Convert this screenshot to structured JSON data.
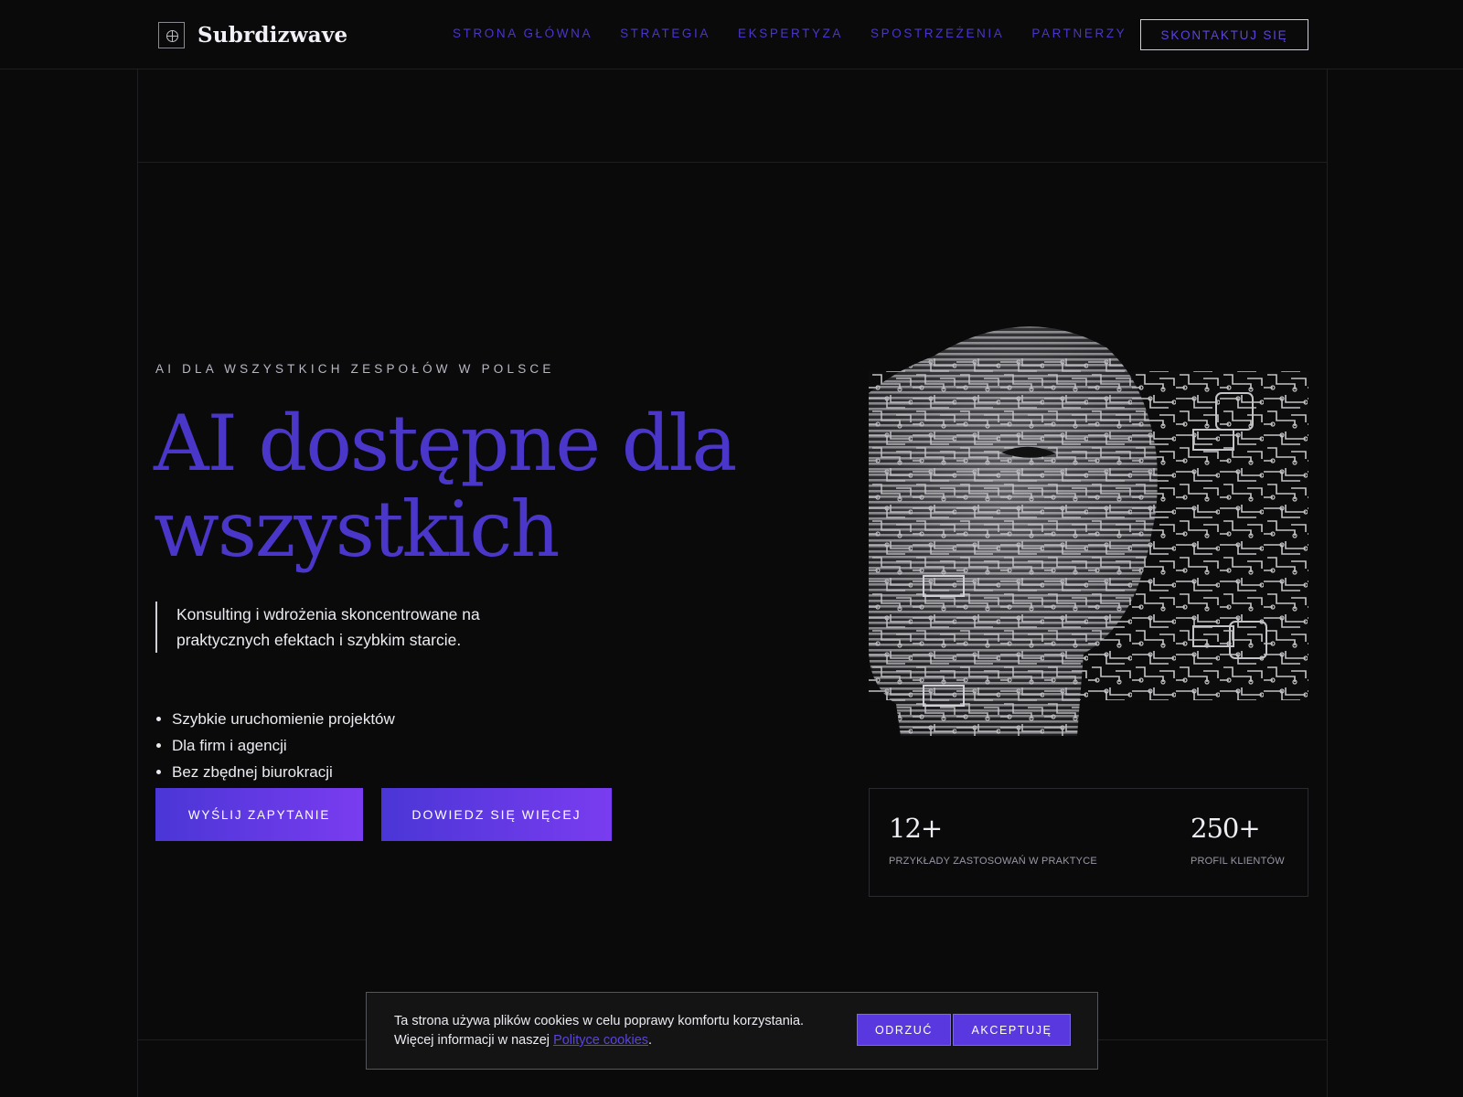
{
  "brand": {
    "name": "Subrdizwave",
    "logo_icon": "crosshair-circle-icon"
  },
  "nav": {
    "items": [
      "STRONA GŁÓWNA",
      "STRATEGIA",
      "EKSPERTYZA",
      "SPOSTRZEŻENIA",
      "PARTNERZY"
    ],
    "cta": "SKONTAKTUJ SIĘ"
  },
  "hero": {
    "eyebrow": "AI DLA WSZYSTKICH ZESPOŁÓW W POLSCE",
    "title_line1": "AI dostępne dla",
    "title_line2": "wszystkich",
    "lead": "Konsulting i wdrożenia skoncentrowane na praktycznych efektach i szybkim starcie.",
    "features": [
      "Szybkie uruchomienie projektów",
      "Dla firm i agencji",
      "Bez zbędnej biurokracji"
    ],
    "primary_button": "WYŚLIJ ZAPYTANIE",
    "secondary_button": "DOWIEDZ SIĘ WIĘCEJ"
  },
  "stats": [
    {
      "value": "12+",
      "label": "PRZYKŁADY ZASTOSOWAŃ W PRAKTYCE"
    },
    {
      "value": "250+",
      "label": "PROFIL KLIENTÓW"
    }
  ],
  "cookie": {
    "text": "Ta strona używa plików cookies w celu poprawy komfortu korzystania. Więcej informacji w naszej ",
    "link": "Polityce cookies",
    "text_end": ".",
    "reject": "ODRZUĆ",
    "accept": "AKCEPTUJĘ"
  },
  "colors": {
    "background": "#0a0a0a",
    "accent": "#4a36c8",
    "button_gradient_start": "#4a36d6",
    "button_gradient_end": "#7a3cf0"
  }
}
